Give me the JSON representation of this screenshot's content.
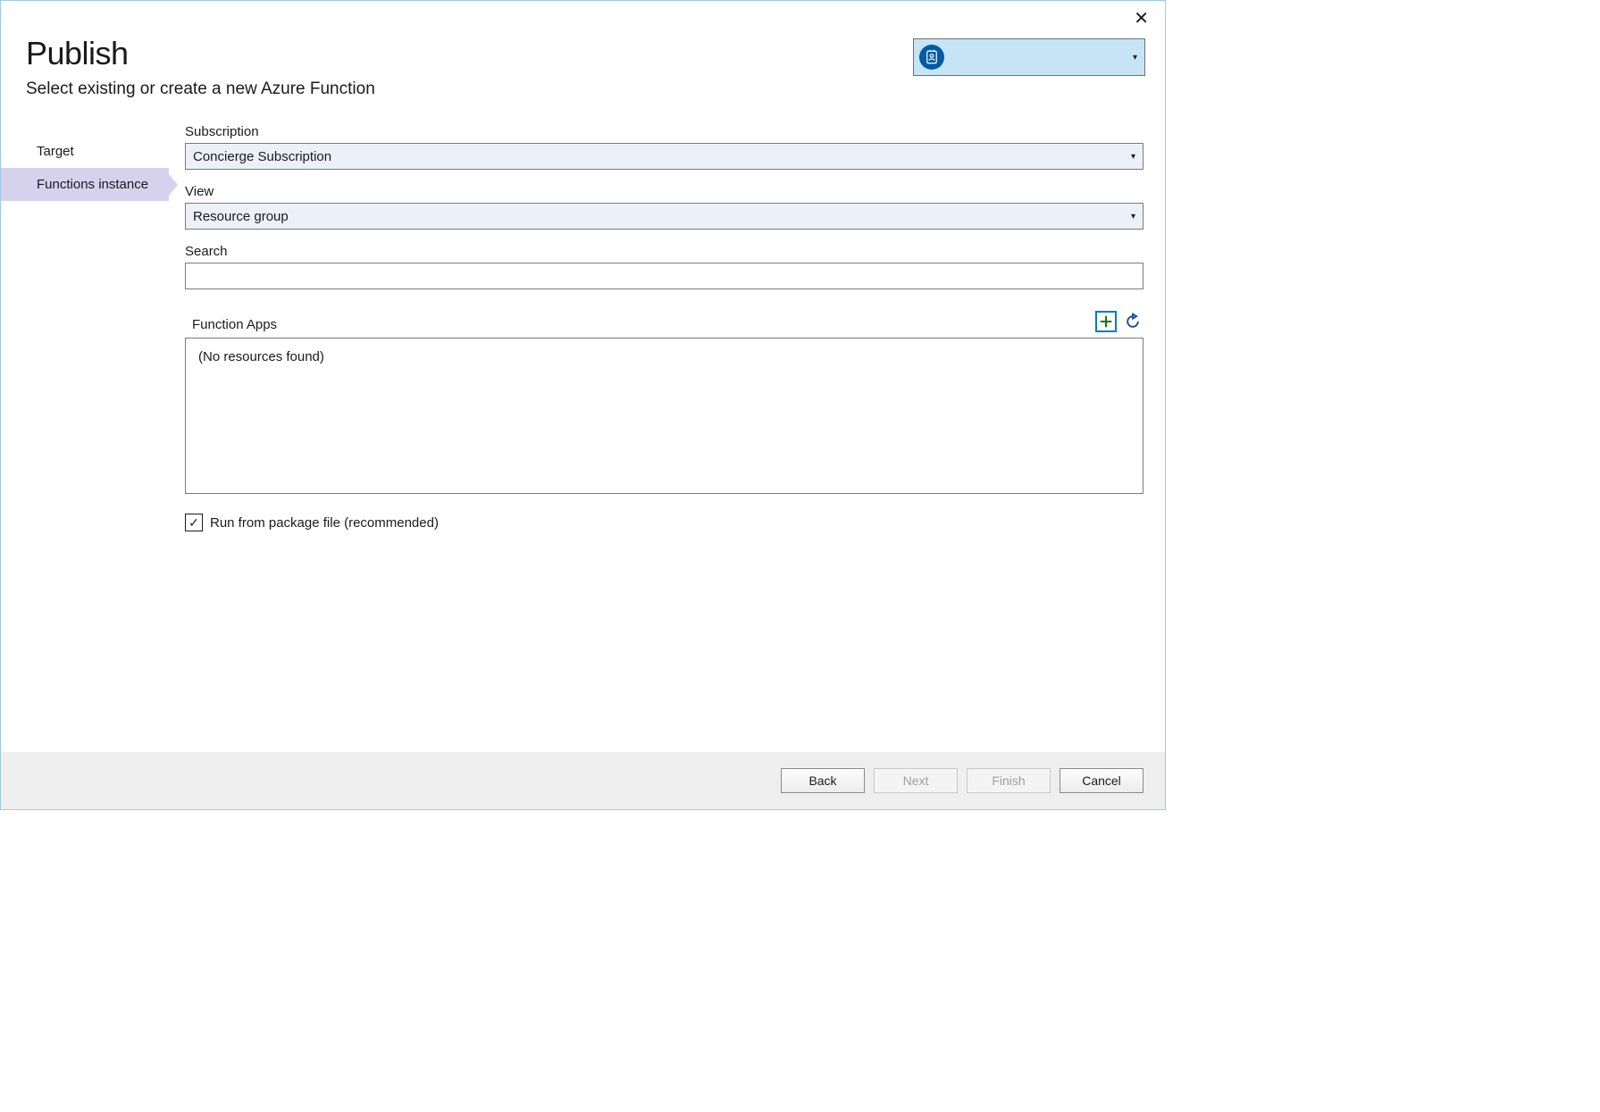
{
  "window": {
    "close_glyph": "✕"
  },
  "header": {
    "title": "Publish",
    "subtitle": "Select existing or create a new Azure Function"
  },
  "account": {
    "caret": "▾"
  },
  "sidebar": {
    "items": [
      {
        "label": "Target",
        "selected": false
      },
      {
        "label": "Functions instance",
        "selected": true
      }
    ]
  },
  "fields": {
    "subscription": {
      "label": "Subscription",
      "value": "Concierge Subscription",
      "caret": "▾"
    },
    "view": {
      "label": "View",
      "value": "Resource group",
      "caret": "▾"
    },
    "search": {
      "label": "Search",
      "value": ""
    },
    "apps": {
      "label": "Function Apps",
      "empty_text": "(No resources found)"
    },
    "run_from_package": {
      "label": "Run from package file (recommended)",
      "checked": true,
      "check_glyph": "✓"
    }
  },
  "footer": {
    "back": "Back",
    "next": "Next",
    "finish": "Finish",
    "cancel": "Cancel"
  }
}
